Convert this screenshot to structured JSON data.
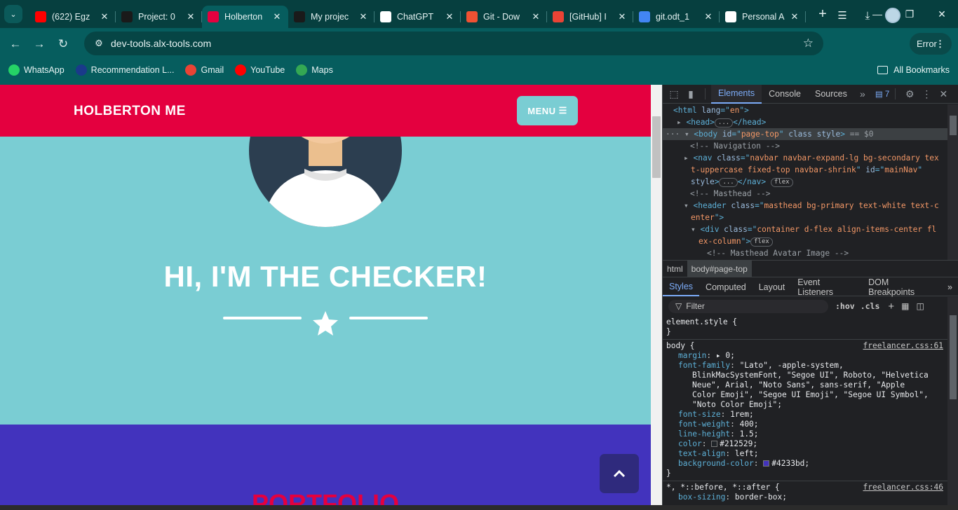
{
  "browser": {
    "tabs": [
      {
        "title": "(622) Egz",
        "icon": "youtube-icon",
        "color": "#ff0000"
      },
      {
        "title": "Project: 0",
        "icon": "alx-icon",
        "color": "#1a1a1a"
      },
      {
        "title": "Holberton",
        "icon": "holberton-icon",
        "color": "#e4003f",
        "active": true
      },
      {
        "title": "My projec",
        "icon": "alx-icon",
        "color": "#1a1a1a"
      },
      {
        "title": "ChatGPT",
        "icon": "chatgpt-icon",
        "color": "#ffffff"
      },
      {
        "title": "Git - Dow",
        "icon": "git-icon",
        "color": "#f05133"
      },
      {
        "title": "[GitHub] I",
        "icon": "gmail-icon",
        "color": "#ea4335"
      },
      {
        "title": "git.odt_1",
        "icon": "docs-icon",
        "color": "#4285f4"
      },
      {
        "title": "Personal A",
        "icon": "github-icon",
        "color": "#ffffff"
      }
    ],
    "url": "dev-tools.alx-tools.com",
    "error_label": "Error",
    "bookmarks": [
      {
        "label": "WhatsApp",
        "icon": "whatsapp-icon",
        "color": "#25d366"
      },
      {
        "label": "Recommendation L...",
        "icon": "bookmark-icon",
        "color": "#1a3a8a"
      },
      {
        "label": "Gmail",
        "icon": "gmail-icon",
        "color": "#ea4335"
      },
      {
        "label": "YouTube",
        "icon": "youtube-icon",
        "color": "#ff0000"
      },
      {
        "label": "Maps",
        "icon": "maps-icon",
        "color": "#34a853"
      }
    ],
    "all_bookmarks": "All Bookmarks"
  },
  "page": {
    "brand": "HOLBERTON ME",
    "menu_label": "MENU",
    "hero_title": "HI, I'M THE CHECKER!",
    "portfolio_title": "PORTFOLIO",
    "colors": {
      "primary": "#7acdd3",
      "secondary": "#e4003f",
      "purple": "#4233bd"
    }
  },
  "devtools": {
    "tabs": [
      "Elements",
      "Console",
      "Sources"
    ],
    "issues_count": "7",
    "dom": {
      "l1a": "<html ",
      "l1b": "lang",
      "l1c": "=\"",
      "l1d": "en",
      "l1e": "\">",
      "head": "<head>",
      "head_close": "</head>",
      "body_tag": "<body ",
      "body_id_attr": "id",
      "body_id": "page-top",
      "body_class": "class style",
      "body_eq": "== $0",
      "nav_comment": "<!-- Navigation -->",
      "nav_tag": "<nav ",
      "nav_class_attr": "class",
      "nav_class_1": "navbar navbar-expand-lg bg-secondary tex",
      "nav_class_2": "t-uppercase fixed-top navbar-shrink",
      "nav_id_attr": "id",
      "nav_id": "mainNav",
      "nav_style": "style",
      "nav_close": "</nav>",
      "masthead_comment": "<!-- Masthead -->",
      "header_tag": "<header ",
      "header_class_attr": "class",
      "header_class_1": "masthead bg-primary text-white text-c",
      "header_class_2": "enter",
      "div_tag": "<div ",
      "div_class_attr": "class",
      "div_class_1": "container d-flex align-items-center fl",
      "div_class_2": "ex-column",
      "avatar_comment": "<!-- Masthead Avatar Image -->",
      "flex_badge": "flex",
      "dots_badge": "..."
    },
    "breadcrumbs": [
      "html",
      "body#page-top"
    ],
    "styles_tabs": [
      "Styles",
      "Computed",
      "Layout",
      "Event Listeners",
      "DOM Breakpoints"
    ],
    "filter_placeholder": "Filter",
    "hov": ":hov",
    "cls": ".cls",
    "rules": {
      "element_style": "element.style {",
      "close": "}",
      "body_selector": "body {",
      "body_source": "freelancer.css:61",
      "margin_n": "margin",
      "margin_v": "0;",
      "ff_n": "font-family",
      "ff_v1": "\"Lato\", -apple-system,",
      "ff_v2": "BlinkMacSystemFont, \"Segoe UI\", Roboto, \"Helvetica",
      "ff_v3": "Neue\", Arial, \"Noto Sans\", sans-serif, \"Apple",
      "ff_v4": "Color Emoji\", \"Segoe UI Emoji\", \"Segoe UI Symbol\",",
      "ff_v5": "\"Noto Color Emoji\";",
      "fs_n": "font-size",
      "fs_v": "1rem;",
      "fw_n": "font-weight",
      "fw_v": "400;",
      "lh_n": "line-height",
      "lh_v": "1.5;",
      "color_n": "color",
      "color_v": "#212529;",
      "ta_n": "text-align",
      "ta_v": "left;",
      "bg_n": "background-color",
      "bg_v": "#4233bd;",
      "universal_selector": "*, *::before, *::after {",
      "universal_source": "freelancer.css:46",
      "bs_n": "box-sizing",
      "bs_v": "border-box;"
    }
  }
}
